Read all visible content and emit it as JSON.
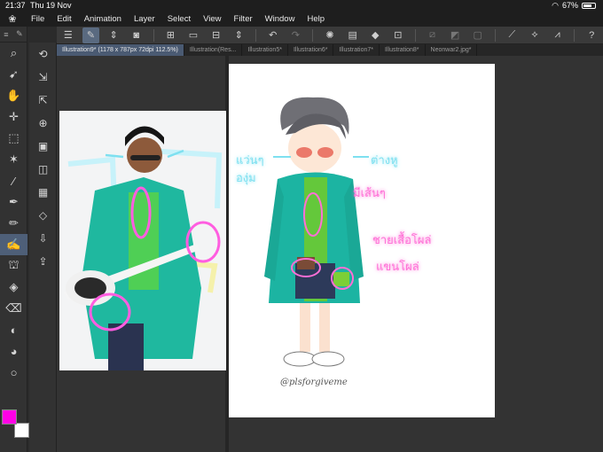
{
  "status_bar": {
    "time": "21:37",
    "date": "Thu 19 Nov",
    "battery": "67%",
    "battery_level": 0.67
  },
  "menu": [
    "File",
    "Edit",
    "Animation",
    "Layer",
    "Select",
    "View",
    "Filter",
    "Window",
    "Help"
  ],
  "tabs": [
    {
      "label": "Illustration9* (1178 x 787px 72dpi 112.5%)",
      "active": true
    },
    {
      "label": "Illustration(Res...",
      "active": false
    },
    {
      "label": "Illustration5*",
      "active": false
    },
    {
      "label": "Illustration6*",
      "active": false
    },
    {
      "label": "Illustration7*",
      "active": false
    },
    {
      "label": "Illustration8*",
      "active": false
    },
    {
      "label": "Neonwar2.jpg*",
      "active": false
    }
  ],
  "colors": {
    "main": "#ff00e6",
    "sub": "#ffffff",
    "accent": "#4e5f78"
  },
  "annotations": {
    "photo": [],
    "drawing": [
      {
        "text": "แว่นๆ",
        "style": "cyan"
      },
      {
        "text": "องุ่ม",
        "style": "cyan"
      },
      {
        "text": "ต่างหู",
        "style": "cyan"
      },
      {
        "text": "มีเส้นๆ",
        "style": "pink"
      },
      {
        "text": "ชายเสื้อโผล่",
        "style": "pink"
      },
      {
        "text": "แขนโผล่",
        "style": "pink"
      }
    ],
    "signature": "@plsforgiveme"
  }
}
